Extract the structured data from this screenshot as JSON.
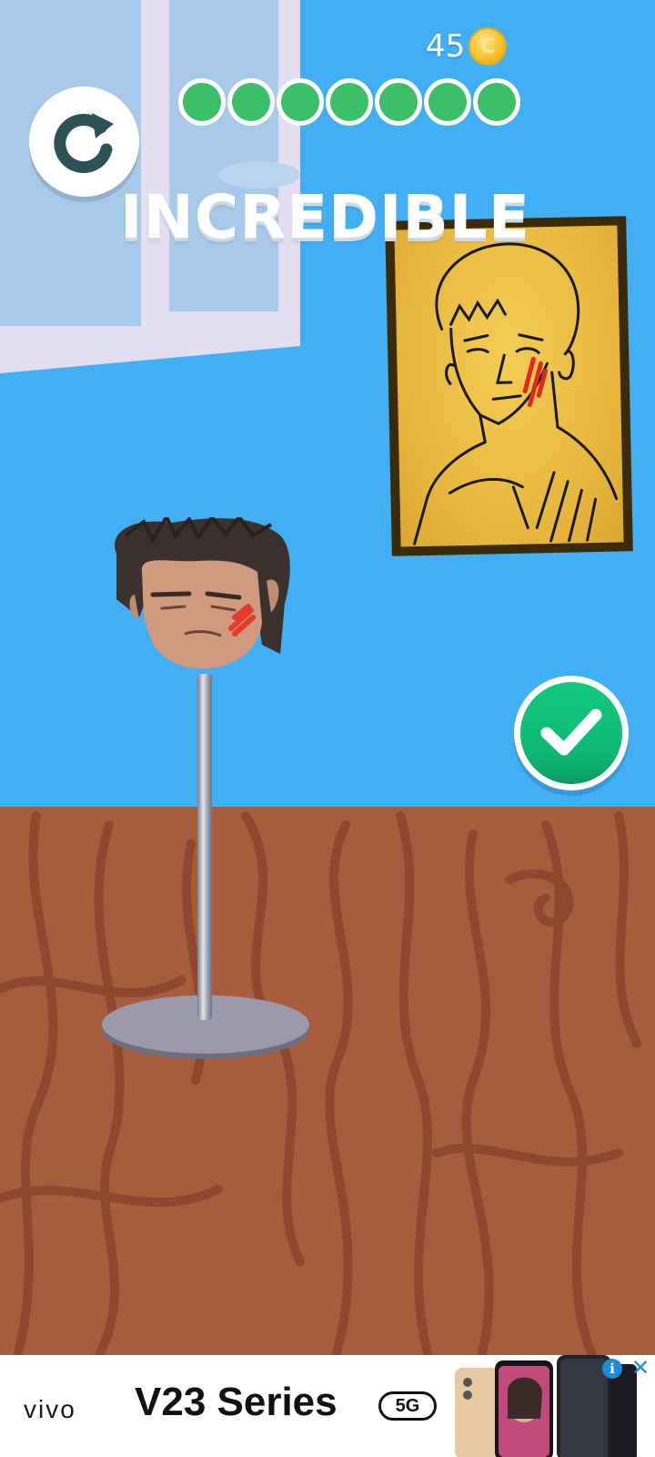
{
  "hud": {
    "coin_count": "45",
    "coin_symbol": "C",
    "rating_text": "INCREDIBLE",
    "progress_dots_filled": 7,
    "progress_dots_total": 7
  },
  "icons": {
    "restart": "restart-icon",
    "confirm": "checkmark-icon",
    "coin": "coin-icon",
    "ad_info": "info-icon",
    "ad_close": "close-icon"
  },
  "colors": {
    "wall": "#42aef4",
    "floor": "#a85c3e",
    "progress_dot": "#3cbf69",
    "confirm_green": "#0db873",
    "restart_icon": "#2c5258"
  },
  "ad": {
    "brand": "vivo",
    "title": "V23 Series",
    "badge": "5G",
    "info_glyph": "i",
    "close_glyph": "✕"
  }
}
